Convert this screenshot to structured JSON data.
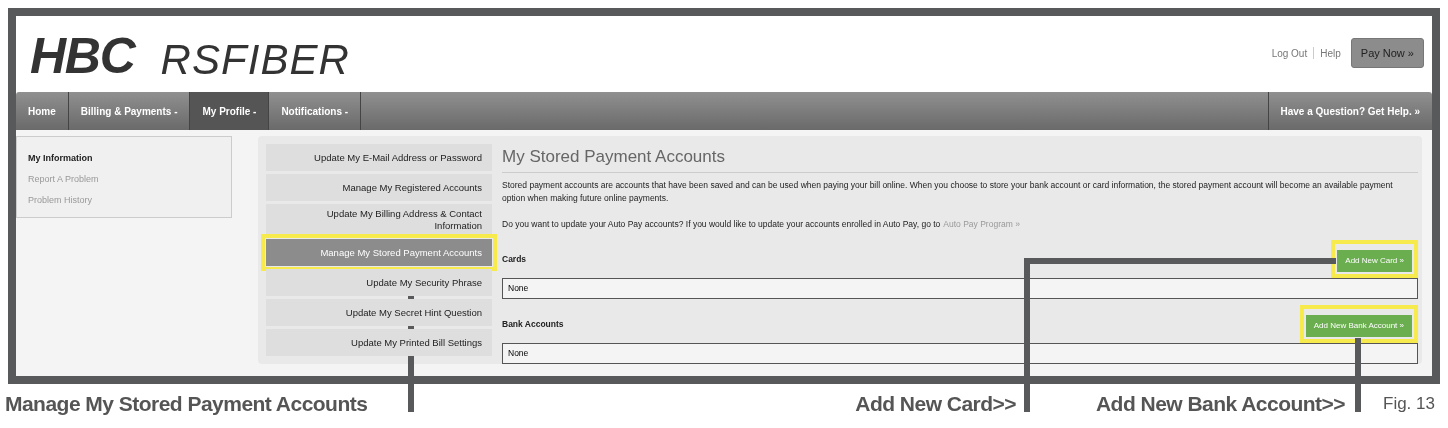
{
  "logo": {
    "primary": "HBC",
    "secondary": "RSFIBER"
  },
  "header_links": [
    "Log Out",
    "Help"
  ],
  "pay_button": "Pay Now »",
  "nav": [
    {
      "label": "Home",
      "selected": false
    },
    {
      "label": "Billing & Payments -",
      "selected": false
    },
    {
      "label": "My Profile -",
      "selected": true
    },
    {
      "label": "Notifications -",
      "selected": false
    }
  ],
  "nav_help": "Have a Question? Get Help. »",
  "sidebar": [
    {
      "label": "My Information",
      "selected": true
    },
    {
      "label": "Report A Problem",
      "selected": false
    },
    {
      "label": "Problem History",
      "selected": false
    }
  ],
  "profile_menu": [
    {
      "label": "Update My E-Mail Address or Password",
      "selected": false,
      "highlighted": false
    },
    {
      "label": "Manage My Registered Accounts",
      "selected": false,
      "highlighted": false
    },
    {
      "label": "Update My Billing Address & Contact Information",
      "selected": false,
      "highlighted": false
    },
    {
      "label": "Manage My Stored Payment Accounts",
      "selected": true,
      "highlighted": true
    },
    {
      "label": "Update My Security Phrase",
      "selected": false,
      "highlighted": false
    },
    {
      "label": "Update My Secret Hint Question",
      "selected": false,
      "highlighted": false
    },
    {
      "label": "Update My Printed Bill Settings",
      "selected": false,
      "highlighted": false
    }
  ],
  "main": {
    "title": "My Stored Payment Accounts",
    "description": "Stored payment accounts are accounts that have been saved and can be used when paying your bill online. When you choose to store your bank account or card information, the stored payment account will become an available payment option when making future online payments.",
    "auto_pay_text": "Do you want to update your Auto Pay accounts? If you would like to update your accounts enrolled in Auto Pay, go to",
    "auto_pay_link": "Auto Pay Program »",
    "sections": [
      {
        "label": "Cards",
        "button": "Add New Card »",
        "button_highlighted": true,
        "value": "None"
      },
      {
        "label": "Bank Accounts",
        "button": "Add New Bank Account »",
        "button_highlighted": true,
        "value": "None"
      }
    ]
  },
  "annotations": [
    "Manage My Stored Payment Accounts",
    "Add New Card>>",
    "Add New Bank Account>>"
  ],
  "figure_label": "Fig. 13"
}
